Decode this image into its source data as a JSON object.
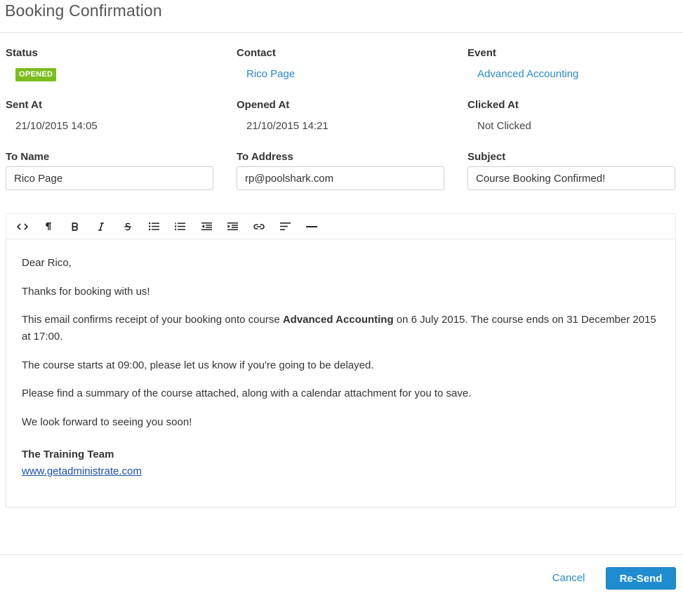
{
  "modal": {
    "title": "Booking Confirmation"
  },
  "fields": {
    "status": {
      "label": "Status",
      "badge": "OPENED",
      "badge_color": "#7cbd1e"
    },
    "contact": {
      "label": "Contact",
      "value": "Rico Page"
    },
    "event": {
      "label": "Event",
      "value": "Advanced Accounting"
    },
    "sent_at": {
      "label": "Sent At",
      "value": "21/10/2015 14:05"
    },
    "opened_at": {
      "label": "Opened At",
      "value": "21/10/2015 14:21"
    },
    "clicked_at": {
      "label": "Clicked At",
      "value": "Not Clicked"
    },
    "to_name": {
      "label": "To Name",
      "value": "Rico Page"
    },
    "to_address": {
      "label": "To Address",
      "value": "rp@poolshark.com"
    },
    "subject": {
      "label": "Subject",
      "value": "Course Booking Confirmed!"
    }
  },
  "toolbar": {
    "tools": [
      "code-view",
      "paragraph",
      "bold",
      "italic",
      "strikethrough",
      "unordered-list",
      "ordered-list",
      "outdent",
      "indent",
      "link",
      "align-left",
      "horizontal-rule"
    ]
  },
  "email_body": {
    "greeting": "Dear Rico,",
    "thanks": "Thanks for booking with us!",
    "confirm_prefix": "This email confirms receipt of your booking onto course ",
    "confirm_course": "Advanced Accounting",
    "confirm_suffix": " on 6 July 2015. The course ends on 31 December 2015 at 17:00.",
    "start_time": "The course starts at 09:00, please let us know if you're going to be delayed.",
    "attachments": "Please find a summary of the course attached, along with a calendar attachment for you to save.",
    "closing": "We look forward to seeing you soon!",
    "signature": "The Training Team",
    "website": "www.getadministrate.com"
  },
  "footer": {
    "cancel_label": "Cancel",
    "resend_label": "Re-Send"
  },
  "colors": {
    "link": "#2a8ac9",
    "primary": "#1f8cd0",
    "badge": "#7cbd1e"
  }
}
